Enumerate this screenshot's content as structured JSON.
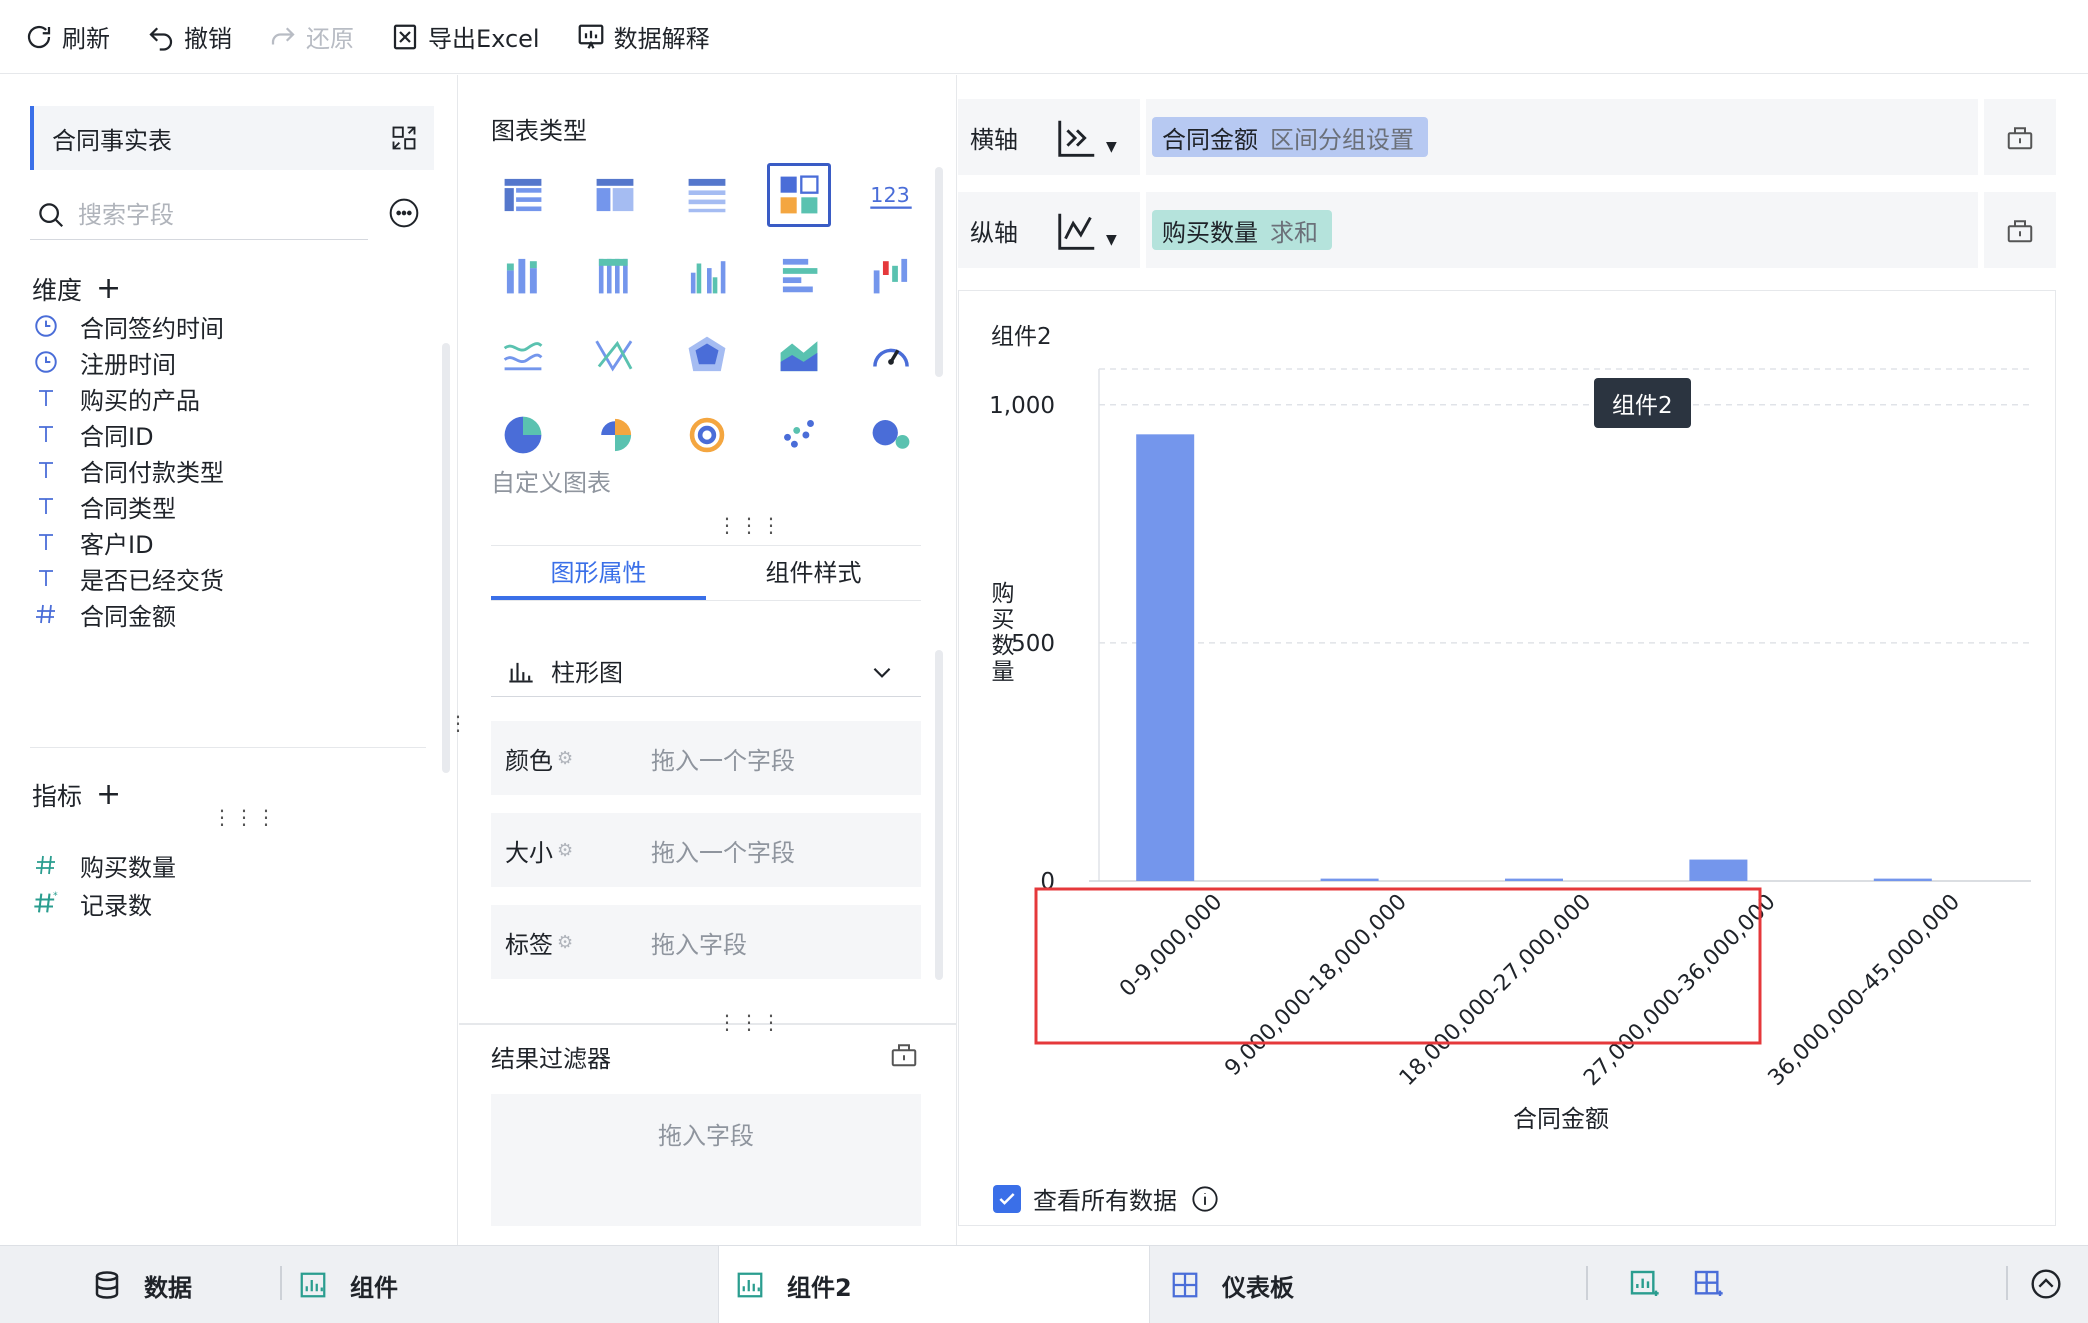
{
  "toolbar": {
    "refresh": "刷新",
    "undo": "撤销",
    "redo": "还原",
    "export_excel": "导出Excel",
    "data_explain": "数据解释"
  },
  "left": {
    "table_name": "合同事实表",
    "search_placeholder": "搜索字段",
    "dimensions_label": "维度",
    "dimensions": [
      {
        "label": "合同签约时间",
        "type": "time"
      },
      {
        "label": "注册时间",
        "type": "time"
      },
      {
        "label": "购买的产品",
        "type": "text"
      },
      {
        "label": "合同ID",
        "type": "text"
      },
      {
        "label": "合同付款类型",
        "type": "text"
      },
      {
        "label": "合同类型",
        "type": "text"
      },
      {
        "label": "客户ID",
        "type": "text"
      },
      {
        "label": "是否已经交货",
        "type": "text"
      },
      {
        "label": "合同金额",
        "type": "number"
      }
    ],
    "measures_label": "指标",
    "measures": [
      {
        "label": "购买数量",
        "type": "number"
      },
      {
        "label": "记录数",
        "type": "count"
      }
    ]
  },
  "middle": {
    "chart_type_title": "图表类型",
    "custom_chart": "自定义图表",
    "tabs": [
      "图形属性",
      "组件样式"
    ],
    "chart_type_value": "柱形图",
    "props": [
      {
        "label": "颜色",
        "placeholder": "拖入一个字段"
      },
      {
        "label": "大小",
        "placeholder": "拖入一个字段"
      },
      {
        "label": "标签",
        "placeholder": "拖入字段"
      }
    ],
    "filter_title": "结果过滤器",
    "filter_placeholder": "拖入字段"
  },
  "axes": {
    "x_label": "横轴",
    "x_field": "合同金额",
    "x_sub": "区间分组设置",
    "y_label": "纵轴",
    "y_field": "购买数量",
    "y_sub": "求和"
  },
  "chart": {
    "title": "组件2",
    "tooltip": "组件2",
    "view_all": "查看所有数据"
  },
  "chart_data": {
    "type": "bar",
    "title": "组件2",
    "categories": [
      "0-9,000,000",
      "9,000,000-18,000,000",
      "18,000,000-27,000,000",
      "27,000,000-36,000,000",
      "36,000,000-45,000,000"
    ],
    "values": [
      938,
      5,
      5,
      45,
      5
    ],
    "xlabel": "合同金额",
    "ylabel": "购买数量",
    "ylim": [
      0,
      1050
    ],
    "yticks": [
      0,
      500,
      1000
    ],
    "ytick_labels": [
      "0",
      "500",
      "1,000"
    ],
    "grid": true,
    "bar_color": "#7496ec",
    "highlight_box_color": "#e5383b"
  },
  "bottom": {
    "data": "数据",
    "component": "组件",
    "component2": "组件2",
    "dashboard": "仪表板"
  },
  "colors": {
    "accent": "#3a6fe8",
    "x_pill": "#b7c9f2",
    "y_pill": "#b5e3dc"
  }
}
